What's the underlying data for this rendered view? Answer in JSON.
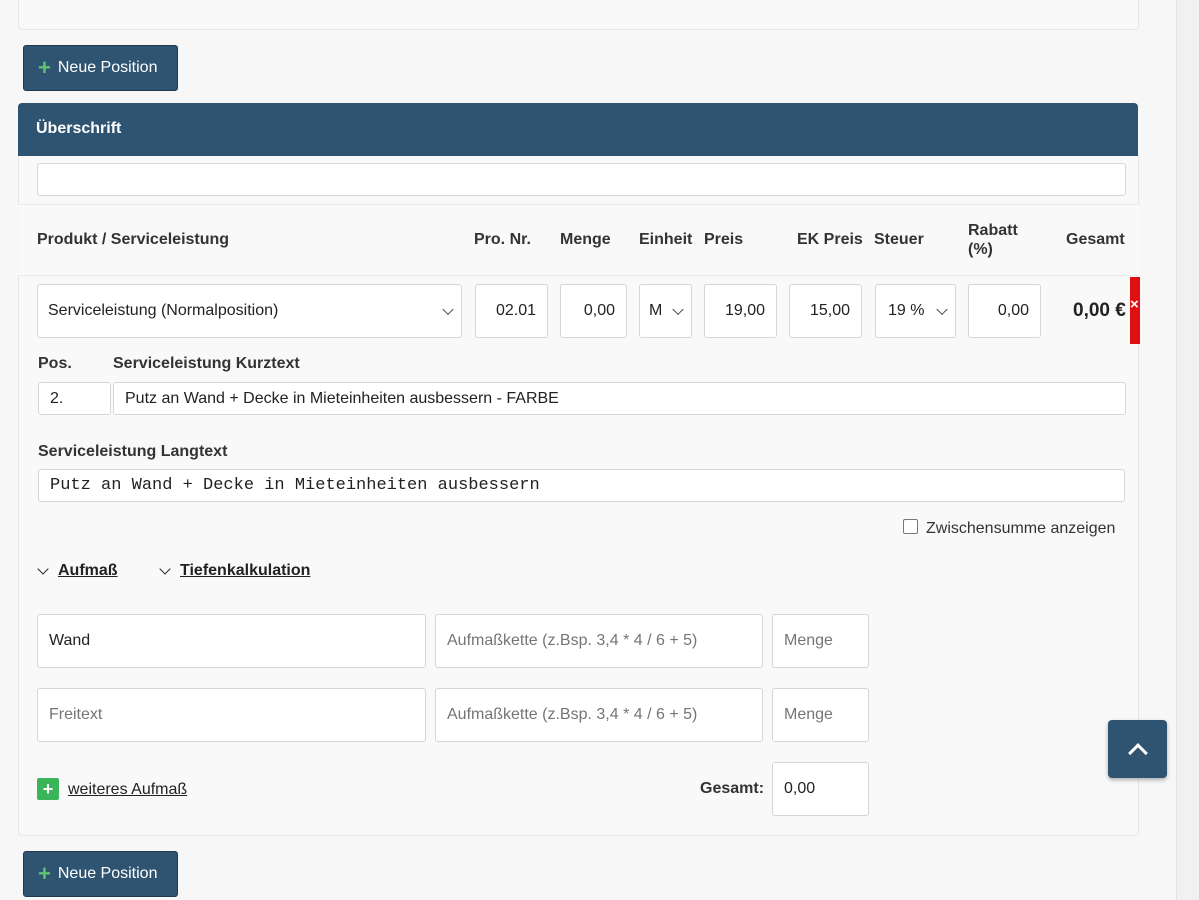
{
  "buttons": {
    "new_position": "Neue Position",
    "new_position_bottom": "Neue Position"
  },
  "header": {
    "title": "Überschrift"
  },
  "heading_input": {
    "value": ""
  },
  "columns": {
    "product": "Produkt / Serviceleistung",
    "pro_nr": "Pro. Nr.",
    "menge": "Menge",
    "einheit": "Einheit",
    "preis": "Preis",
    "ek_preis": "EK Preis",
    "steuer": "Steuer",
    "rabatt": "Rabatt (%)",
    "gesamt": "Gesamt"
  },
  "row": {
    "product_select": "Serviceleistung (Normalposition)",
    "pro_nr": "02.01",
    "menge": "0,00",
    "einheit": "M",
    "preis": "19,00",
    "ek_preis": "15,00",
    "steuer": "19 %",
    "rabatt": "0,00",
    "gesamt": "0,00 €",
    "close_glyph": "×"
  },
  "pos": {
    "label": "Pos.",
    "value": "2."
  },
  "kurztext": {
    "label": "Serviceleistung Kurztext",
    "value": "Putz an Wand + Decke in Mieteinheiten ausbessern - FARBE"
  },
  "langtext": {
    "label": "Serviceleistung Langtext",
    "value": "Putz an Wand + Decke in Mieteinheiten ausbessern"
  },
  "zwischensumme": {
    "label": "Zwischensumme anzeigen",
    "checked": false
  },
  "tabs": {
    "aufmass": "Aufmaß",
    "tiefenkalkulation": "Tiefenkalkulation"
  },
  "aufmass_rows": [
    {
      "text": "Wand",
      "text_placeholder": "",
      "chain_placeholder": "Aufmaßkette (z.Bsp. 3,4 * 4 / 6 + 5)",
      "menge_placeholder": "Menge"
    },
    {
      "text": "",
      "text_placeholder": "Freitext",
      "chain_placeholder": "Aufmaßkette (z.Bsp. 3,4 * 4 / 6 + 5)",
      "menge_placeholder": "Menge"
    }
  ],
  "weiteres": {
    "label": "weiteres Aufmaß",
    "icon": "plus-icon"
  },
  "gesamt": {
    "label": "Gesamt:",
    "value": "0,00"
  },
  "colors": {
    "header_blue": "#2e5472",
    "plus_green": "#3bb55a",
    "delete_red": "#e01010"
  }
}
